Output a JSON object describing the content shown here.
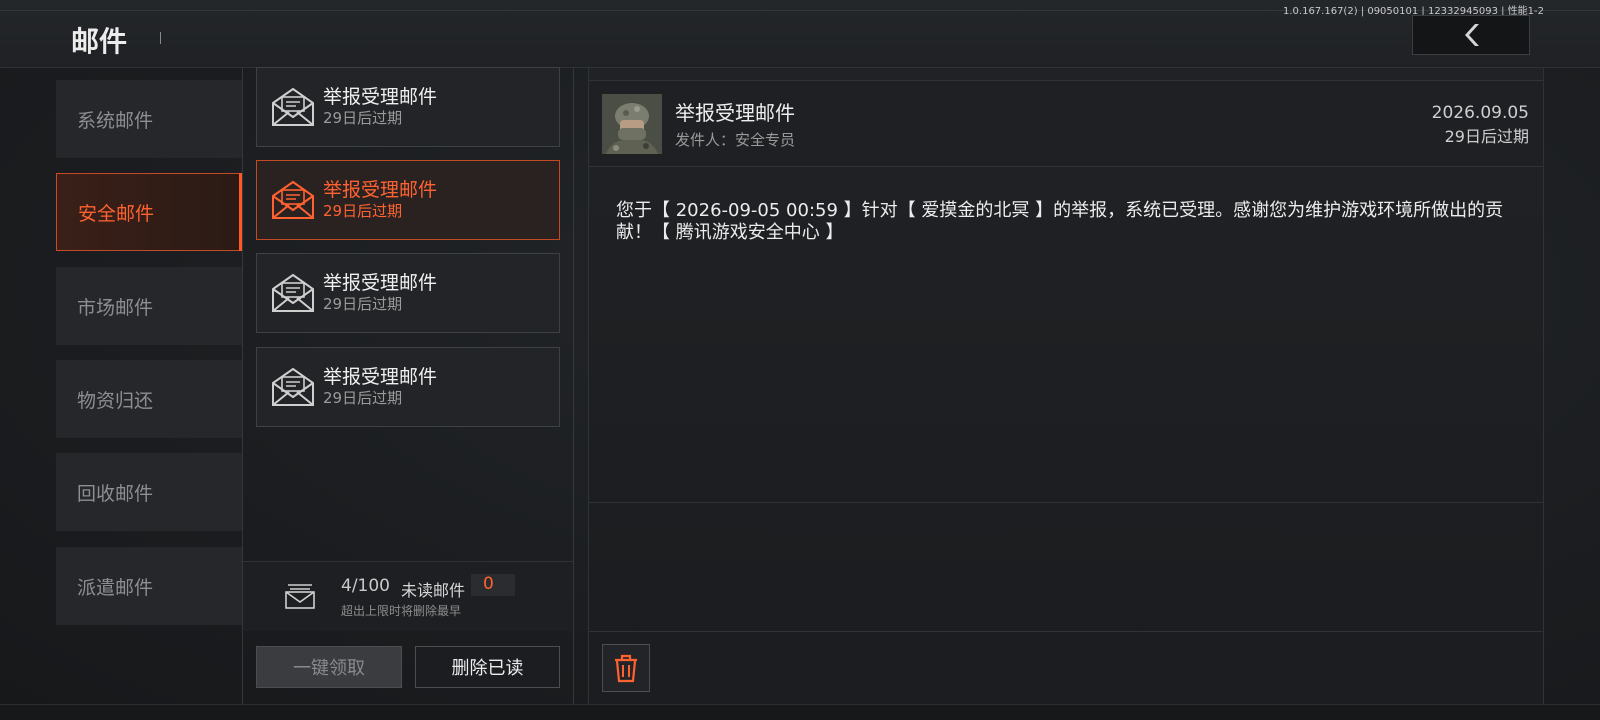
{
  "header": {
    "title": "邮件",
    "version": "1.0.167.167(2) | 09050101 | 12332945093 | 性能1-2"
  },
  "categories": [
    {
      "label": "系统邮件"
    },
    {
      "label": "安全邮件",
      "active": true
    },
    {
      "label": "市场邮件"
    },
    {
      "label": "物资归还"
    },
    {
      "label": "回收邮件"
    },
    {
      "label": "派遣邮件"
    }
  ],
  "mails": [
    {
      "title": "举报受理邮件",
      "expire": "29日后过期"
    },
    {
      "title": "举报受理邮件",
      "expire": "29日后过期",
      "active": true
    },
    {
      "title": "举报受理邮件",
      "expire": "29日后过期"
    },
    {
      "title": "举报受理邮件",
      "expire": "29日后过期"
    }
  ],
  "mailbox": {
    "count": "4/100",
    "unread_label": "未读邮件",
    "unread_value": "0",
    "hint": "超出上限时将删除最早"
  },
  "buttons": {
    "claim_all": "一键领取",
    "delete_read": "删除已读"
  },
  "detail": {
    "title": "举报受理邮件",
    "sender": "发件人：安全专员",
    "date": "2026.09.05",
    "expire": "29日后过期",
    "body": "您于【 2026-09-05 00:59 】针对【 爱摸金的北冥 】的举报，系统已受理。感谢您为维护游戏环境所做出的贡献！【 腾讯游戏安全中心 】"
  },
  "colors": {
    "accent": "#ff6230",
    "active_border": "#c24a25"
  },
  "icons": {
    "back": "chevron-left-icon",
    "mail": "open-envelope-icon",
    "mailbox": "stacked-envelopes-icon",
    "trash": "trash-icon"
  }
}
